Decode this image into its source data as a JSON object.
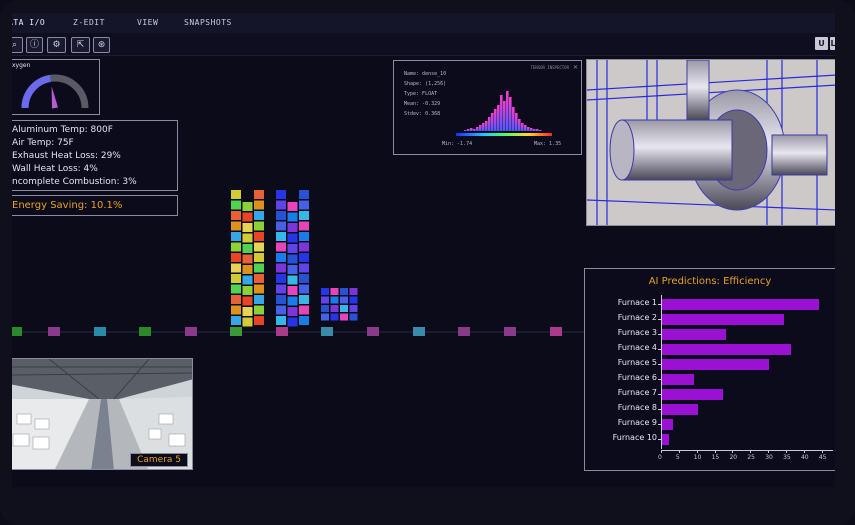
{
  "menu": {
    "items": [
      "ATA I/O",
      "Z-EDIT",
      "VIEW",
      "SNAPSHOTS"
    ]
  },
  "toolbar": {
    "right_buttons": [
      "U",
      "L"
    ]
  },
  "gauge": {
    "title": "xygen",
    "fill_fraction": 0.45
  },
  "stats": {
    "lines": [
      "Aluminum Temp: 800F",
      "Air Temp: 75F",
      "Exhaust Heat Loss: 29%",
      "Wall Heat Loss: 4%",
      "ncomplete Combustion: 3%"
    ],
    "energy_saving": "Energy Saving: 10.1%"
  },
  "inspector": {
    "header": "TENSOR INSPECTOR",
    "name": "Name: dense_10",
    "shape": "Shape: (1,256)",
    "type": "Type: FLOAT",
    "mean": "Mean: -0.329",
    "stdev": "Stdev: 0.368",
    "min": "Min: -1.74",
    "max": "Max: 1.35"
  },
  "camera": {
    "label": "Camera 5"
  },
  "colors": {
    "accent": "#9a11d4",
    "gold": "#e8a21c",
    "panel_border": "#8c8ca0"
  },
  "chart_data": {
    "type": "bar",
    "orientation": "horizontal",
    "title": "AI Predictions: Efficiency",
    "categories": [
      "Furnace 1",
      "Furnace 2",
      "Furnace 3",
      "Furnace 4",
      "Furnace 5",
      "Furnace 6",
      "Furnace 7",
      "Furnace 8",
      "Furnace 9",
      "Furnace 10"
    ],
    "values": [
      44,
      34,
      18,
      36,
      30,
      9,
      17,
      10,
      3,
      2
    ],
    "xticks": [
      0,
      5,
      10,
      15,
      20,
      25,
      30,
      35,
      40,
      45
    ],
    "xlim": [
      0,
      47
    ],
    "color": "#9a11d4"
  }
}
